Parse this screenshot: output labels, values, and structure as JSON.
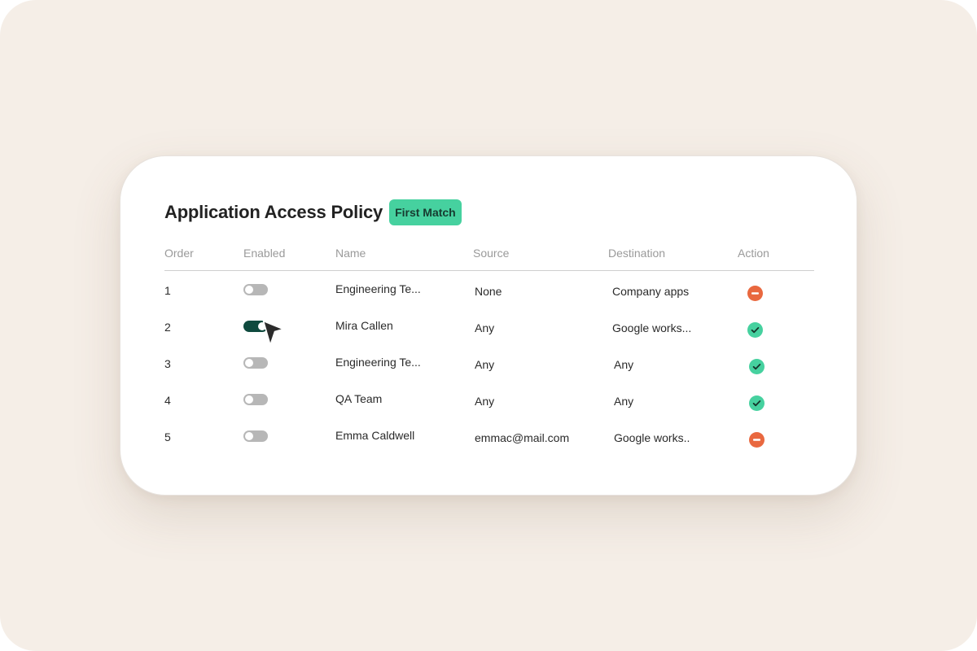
{
  "policy": {
    "title": "Application Access Policy",
    "mode_badge": "First Match"
  },
  "columns": {
    "order": "Order",
    "enabled": "Enabled",
    "name": "Name",
    "source": "Source",
    "destination": "Destination",
    "action": "Action"
  },
  "rows": [
    {
      "order": "1",
      "enabled": false,
      "name": "Engineering Te...",
      "source": "None",
      "destination": "Company apps",
      "action": "deny"
    },
    {
      "order": "2",
      "enabled": true,
      "name": "Mira Callen",
      "source": "Any",
      "destination": "Google works...",
      "action": "allow"
    },
    {
      "order": "3",
      "enabled": false,
      "name": "Engineering Te...",
      "source": "Any",
      "destination": "Any",
      "action": "allow"
    },
    {
      "order": "4",
      "enabled": false,
      "name": "QA Team",
      "source": "Any",
      "destination": "Any",
      "action": "allow"
    },
    {
      "order": "5",
      "enabled": false,
      "name": "Emma Caldwell",
      "source": "emmac@mail.com",
      "destination": "Google works..",
      "action": "deny"
    }
  ],
  "colors": {
    "background": "#f5eee7",
    "badge": "#46d19f",
    "toggle_on": "#0f4a3e",
    "toggle_off": "#b7b7b7",
    "allow": "#46d19f",
    "deny": "#e9683f"
  },
  "icons": {
    "allow": "check-circle-icon",
    "deny": "minus-circle-icon",
    "pointer": "mouse-pointer-icon"
  }
}
